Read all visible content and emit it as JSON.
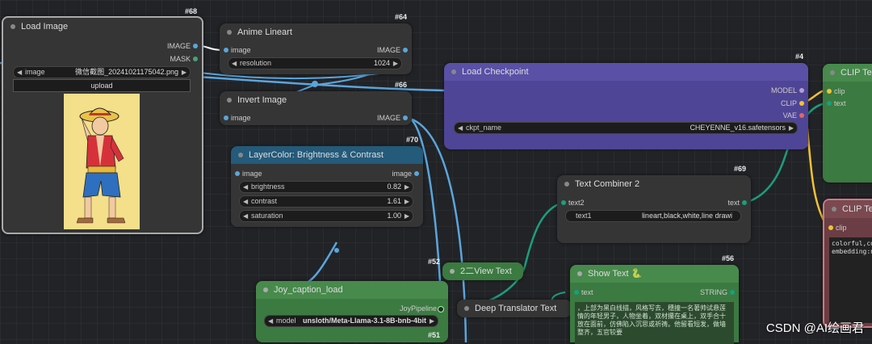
{
  "nodes": {
    "load_image": {
      "id": "#68",
      "title": "Load Image",
      "outputs": [
        "IMAGE",
        "MASK"
      ],
      "image_label": "image",
      "image_value": "微信截图_20241021175042.png",
      "upload_label": "upload"
    },
    "anime_lineart": {
      "id": "#64",
      "title": "Anime Lineart",
      "input": "image",
      "output": "IMAGE",
      "resolution_label": "resolution",
      "resolution_value": "1024"
    },
    "invert_image": {
      "id": "#66",
      "title": "Invert Image",
      "input": "image",
      "output": "IMAGE"
    },
    "layer_color": {
      "id": "#70",
      "title": "LayerColor: Brightness & Contrast",
      "input": "image",
      "output": "image",
      "widgets": [
        {
          "label": "brightness",
          "value": "0.82"
        },
        {
          "label": "contrast",
          "value": "1.61"
        },
        {
          "label": "saturation",
          "value": "1.00"
        }
      ]
    },
    "load_checkpoint": {
      "id": "#4",
      "title": "Load Checkpoint",
      "outputs": [
        "MODEL",
        "CLIP",
        "VAE"
      ],
      "ckpt_label": "ckpt_name",
      "ckpt_value": "CHEYENNE_v16.safetensors"
    },
    "clip_text_top": {
      "title": "CLIP Te",
      "inputs": [
        "clip",
        "text"
      ]
    },
    "clip_text_bottom": {
      "title": "CLIP Te",
      "input": "clip",
      "text_lines": [
        "colorful,co",
        "embedding:n"
      ]
    },
    "text_combiner": {
      "id": "#69",
      "title": "Text Combiner 2",
      "input": "text2",
      "output": "text",
      "text1_label": "text1",
      "text1_value": "lineart,black,white,line drawi"
    },
    "view_text": {
      "id": "#52",
      "title": "2二View Text"
    },
    "joy_caption": {
      "title": "Joy_caption_load",
      "output": "JoyPipeline",
      "model_label": "model",
      "model_value": "unsloth/Meta-Llama-3.1-8B-bnb-4bit",
      "bottom_id": "#51"
    },
    "deep_translator": {
      "title": "Deep Translator Text"
    },
    "show_text": {
      "id": "#56",
      "title": "Show Text 🐍",
      "input": "text",
      "output": "STRING",
      "content": "，上部为黑白线描，风格写去，穗撞一名著帅试悬莲情的年轻男子，人物坐着，双材攥在桌上，双手合十放在面前，仿佛陷入沉思或祈祷。他留看短发，做墙整齐，五官较要"
    }
  },
  "watermark": "CSDN @AI绘画君",
  "colors": {
    "canvas": "#222327",
    "purple_node": "#4f4596",
    "green_node": "#3b7a40",
    "red_node": "#6a3e44",
    "dark_node": "#353535",
    "blue_title": "#245a7a",
    "wire_blue": "#5aa6dc",
    "wire_teal": "#1b9e7d",
    "wire_yellow": "#f1c232"
  }
}
